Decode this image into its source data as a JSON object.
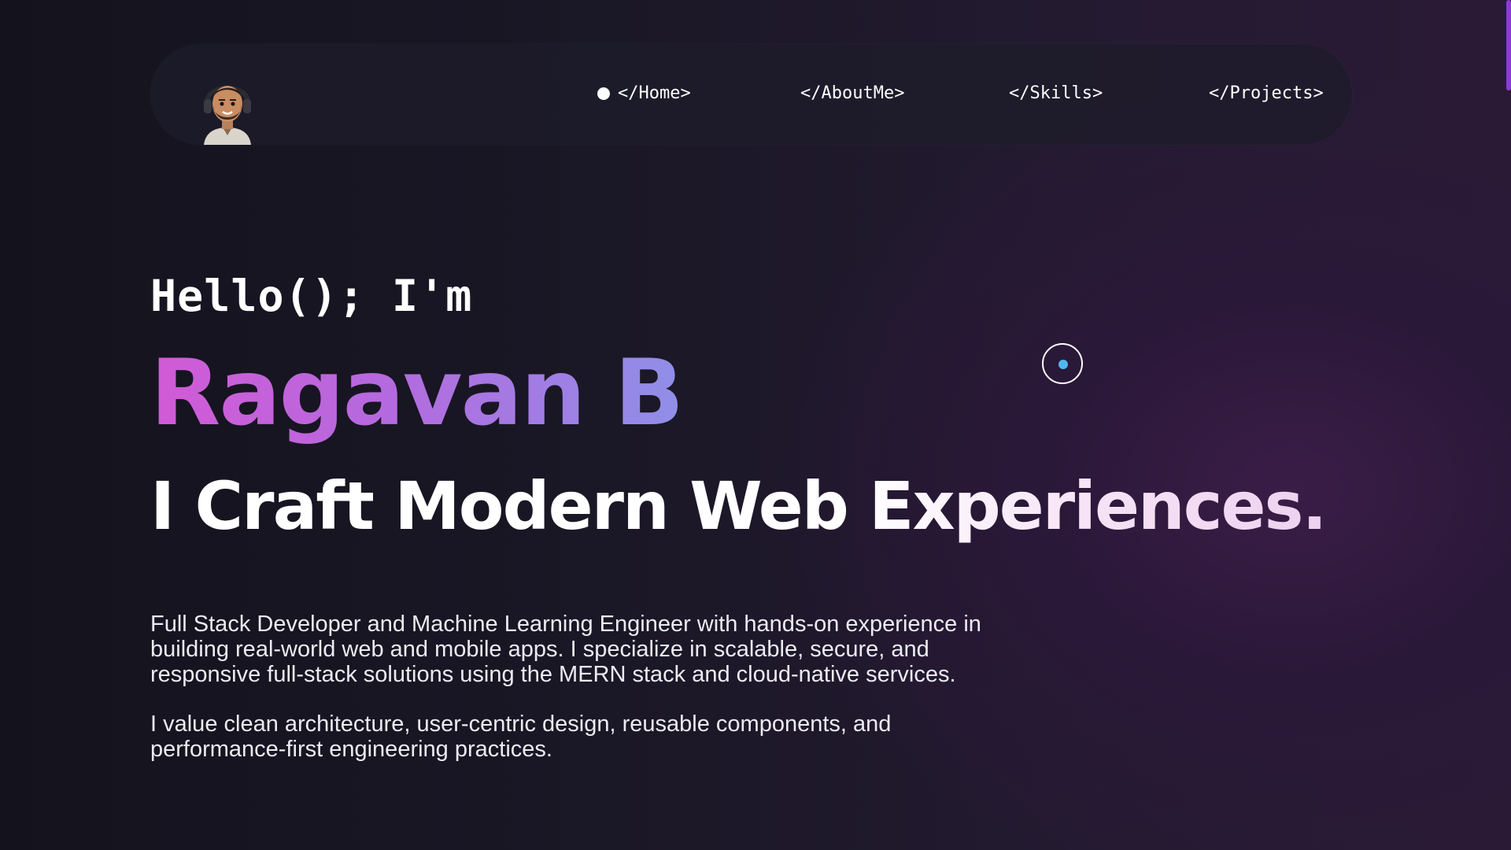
{
  "nav": {
    "items": [
      {
        "label": "</Home>",
        "active": true
      },
      {
        "label": "</AboutMe>",
        "active": false
      },
      {
        "label": "</Skills>",
        "active": false
      },
      {
        "label": "</Projects>",
        "active": false
      }
    ],
    "avatar_icon": "developer-avatar-with-headphones"
  },
  "hero": {
    "greeting": "Hello(); I'm",
    "name": "Ragavan B",
    "tagline": "I Craft Modern Web Experiences.",
    "paragraphs": [
      "Full Stack Developer and Machine Learning Engineer with hands-on experience in building real-world web and mobile apps. I specialize in scalable, secure, and responsive full-stack solutions using the MERN stack and cloud-native services.",
      "I value clean architecture, user-centric design, reusable components, and performance-first engineering practices."
    ]
  },
  "colors": {
    "accent_gradient_start": "#d25ad6",
    "accent_gradient_end": "#8f8fe8",
    "scrollbar": "#8b3bd8",
    "cursor_dot": "#4fb8ef"
  }
}
